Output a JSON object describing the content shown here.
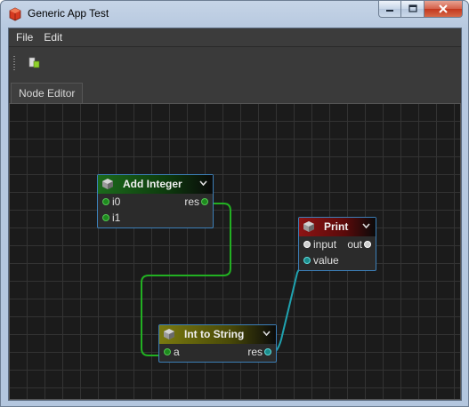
{
  "window": {
    "title": "Generic App Test",
    "app_icon": "cube-stack-icon"
  },
  "menu": {
    "items": [
      "File",
      "Edit"
    ]
  },
  "toolbar": {
    "tool_icon": "node-add-icon"
  },
  "tabs": [
    {
      "label": "Node Editor"
    }
  ],
  "nodes": {
    "add_integer": {
      "title": "Add Integer",
      "header_color": "#1c6a1c",
      "inputs": [
        "i0",
        "i1"
      ],
      "outputs": [
        "res"
      ]
    },
    "print": {
      "title": "Print",
      "header_color": "#8c1414",
      "inputs": [
        "input",
        "value"
      ],
      "outputs": [
        "out"
      ]
    },
    "int_to_string": {
      "title": "Int to String",
      "header_color": "#7a7a10",
      "inputs": [
        "a"
      ],
      "outputs": [
        "res"
      ]
    }
  },
  "colors": {
    "node_border": "#3c7fb8",
    "wire_int": "#22b022",
    "wire_string": "#1fa3b0",
    "canvas_bg": "#1b1b1b"
  }
}
